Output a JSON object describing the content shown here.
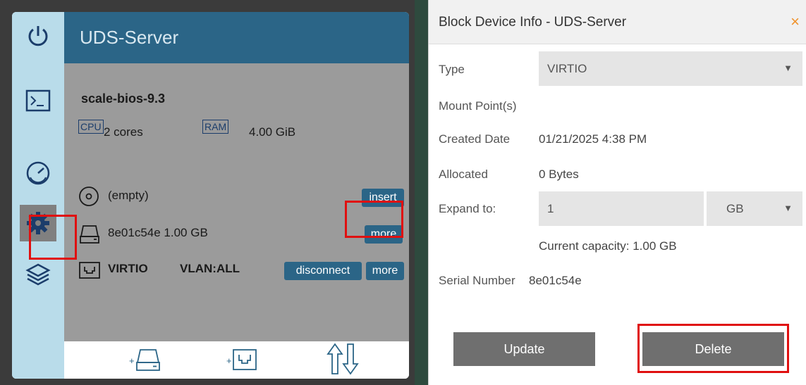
{
  "vm_panel": {
    "title": "UDS-Server",
    "vm_name": "scale-bios-9.3",
    "cpu": {
      "tag": "CPU",
      "value": "2 cores"
    },
    "ram": {
      "tag": "RAM",
      "value": "4.00 GiB"
    },
    "devices": [
      {
        "icon": "optical-disc-icon",
        "label": "(empty)",
        "button": "insert"
      },
      {
        "icon": "disk-drive-icon",
        "label": "8e01c54e  1.00 GB",
        "button": "more"
      },
      {
        "icon": "network-card-icon",
        "label": "VIRTIO",
        "vlan": "VLAN:ALL",
        "button_disconnect": "disconnect",
        "button_more": "more"
      }
    ],
    "sidebar": [
      "power-icon",
      "console-icon",
      "performance-gauge-icon",
      "settings-gear-icon",
      "snapshots-layers-icon"
    ],
    "footer": [
      "add-disk-icon",
      "add-network-icon",
      "import-export-icon"
    ]
  },
  "dialog": {
    "title": "Block Device Info - UDS-Server",
    "close": "×",
    "type_label": "Type",
    "type_value": "VIRTIO",
    "mount_label": "Mount Point(s)",
    "created_label": "Created Date",
    "created_value": "01/21/2025 4:38 PM",
    "allocated_label": "Allocated",
    "allocated_value": "0 Bytes",
    "expand_label": "Expand to:",
    "expand_value": "1",
    "expand_unit": "GB",
    "capacity_note": "Current capacity: 1.00 GB",
    "serial_label": "Serial Number",
    "serial_value": "8e01c54e",
    "update_button": "Update",
    "delete_button": "Delete"
  },
  "colors": {
    "accent_blue": "#2b6587",
    "sidebar_bg": "#b9dcea",
    "highlight_red": "#e01010",
    "close_orange": "#f0922a"
  }
}
